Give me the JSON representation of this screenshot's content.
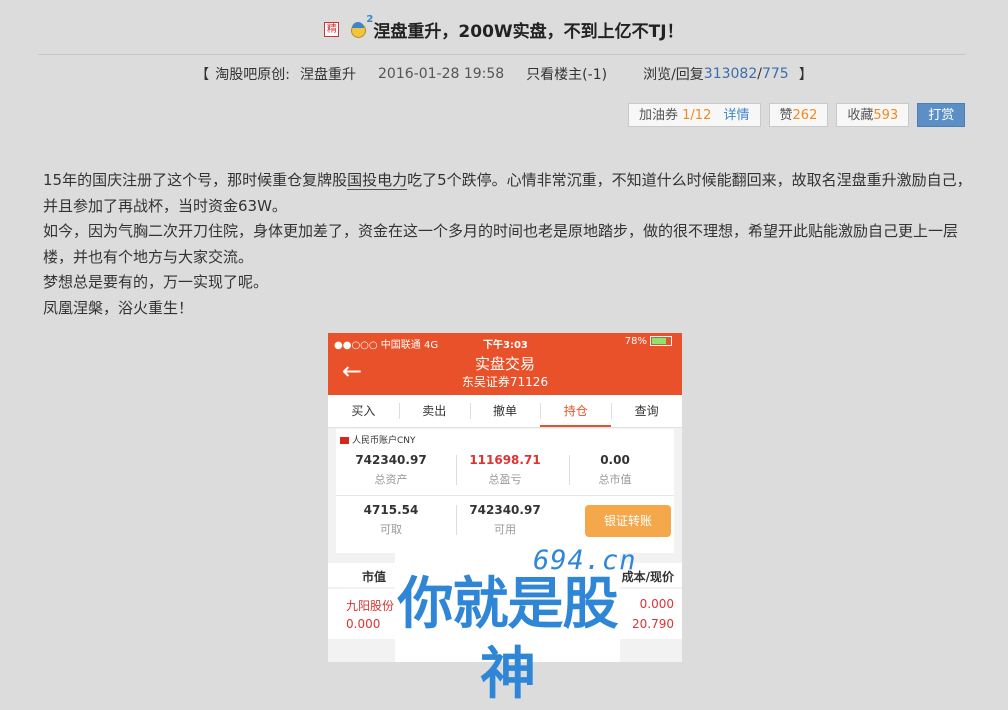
{
  "post": {
    "badge": "精",
    "level_sup": "2",
    "title": "涅盘重升，200W实盘，不到上亿不TJ！"
  },
  "meta": {
    "open_bracket": "【",
    "forum": "淘股吧原创:",
    "author": "涅盘重升",
    "datetime": "2016-01-28 19:58",
    "only_op": "只看楼主(-1)",
    "views_label": "浏览/回复",
    "views": "313082",
    "slash": "/",
    "replies": "775",
    "close_bracket": "】"
  },
  "actions": {
    "fuel_label": "加油券",
    "fuel_value": "1/12",
    "detail": "详情",
    "like_label": "赞",
    "like_count": "262",
    "fav_label": "收藏",
    "fav_count": "593",
    "tip": "打赏"
  },
  "body": {
    "p1_a": "15年的国庆注册了这个号，那时候重仓复牌股",
    "p1_link": "国投电力",
    "p1_b": "吃了5个跌停。心情非常沉重，不知道什么时候能翻回来，故取名涅盘重升激励自己，并且参加了再战杯，当时资金63W。",
    "p2": "如今，因为气胸二次开刀住院，身体更加差了，资金在这一个多月的时间也老是原地踏步，做的很不理想，希望开此贴能激励自己更上一层楼，并也有个地方与大家交流。",
    "p3": "梦想总是要有的，万一实现了呢。",
    "p4": "凤凰涅槃，浴火重生！"
  },
  "phone": {
    "carrier": "●●○○○ 中国联通  4G",
    "time": "下午3:03",
    "battery": "78%",
    "back_icon": "←",
    "title": "实盘交易",
    "subtitle": "东吴证券71126",
    "tabs": [
      "买入",
      "卖出",
      "撤单",
      "持仓",
      "查询"
    ],
    "account_label": "人民币账户CNY",
    "stats": {
      "total_assets_value": "742340.97",
      "total_assets_label": "总资产",
      "pnl_value": "111698.71",
      "pnl_label": "总盈亏",
      "market_value": "0.00",
      "market_label": "总市值",
      "withdrawable_value": "4715.54",
      "withdrawable_label": "可取",
      "available_value": "742340.97",
      "available_label": "可用"
    },
    "transfer_button": "银证转账",
    "table_headers": [
      "市值",
      "成本/现价"
    ],
    "row": {
      "name": "九阳股份",
      "market_value": "0.000",
      "cost": "0.000",
      "price": "20.790"
    }
  },
  "watermark": {
    "domain": "694.cn",
    "slogan": "你就是股神"
  },
  "colors": {
    "phone_header": "#e8512a",
    "link_blue": "#3d6ea8",
    "count_orange": "#f08a1c",
    "tip_button": "#5b8fc6",
    "watermark_blue": "#2f86d6"
  }
}
